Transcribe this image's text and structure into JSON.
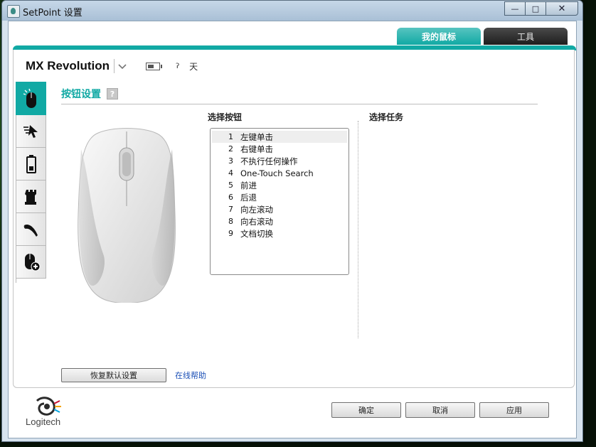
{
  "window": {
    "title": "SetPoint 设置",
    "controls": {
      "minimize": "—",
      "maximize": "□",
      "close": "✕"
    }
  },
  "top_tabs": [
    {
      "label": "我的鼠标",
      "active": true
    },
    {
      "label": "工具",
      "active": false
    }
  ],
  "device": {
    "name": "MX Revolution",
    "signal_label": "ʔ",
    "days_label": "天"
  },
  "side_tabs": [
    {
      "icon": "mouse-buttons-icon",
      "active": true
    },
    {
      "icon": "pointer-speed-icon",
      "active": false
    },
    {
      "icon": "battery-icon",
      "active": false
    },
    {
      "icon": "game-rook-icon",
      "active": false
    },
    {
      "icon": "scroll-wheel-icon",
      "active": false
    },
    {
      "icon": "mouse-add-icon",
      "active": false
    }
  ],
  "section": {
    "title": "按钮设置",
    "help_mark": "?"
  },
  "columns": {
    "select_button": "选择按钮",
    "select_task": "选择任务"
  },
  "buttons_list": [
    {
      "num": "1",
      "label": "左键单击",
      "selected": true
    },
    {
      "num": "2",
      "label": "右键单击",
      "selected": false
    },
    {
      "num": "3",
      "label": "不执行任何操作",
      "selected": false
    },
    {
      "num": "4",
      "label": "One-Touch Search",
      "selected": false
    },
    {
      "num": "5",
      "label": "前进",
      "selected": false
    },
    {
      "num": "6",
      "label": "后退",
      "selected": false
    },
    {
      "num": "7",
      "label": "向左滚动",
      "selected": false
    },
    {
      "num": "8",
      "label": "向右滚动",
      "selected": false
    },
    {
      "num": "9",
      "label": "文档切换",
      "selected": false
    }
  ],
  "restore_label": "恢复默认设置",
  "online_help_label": "在线帮助",
  "logo_text": "Logitech",
  "footer": {
    "ok": "确定",
    "cancel": "取消",
    "apply": "应用"
  },
  "colors": {
    "accent": "#11a9a4",
    "link": "#1a4fb6"
  }
}
